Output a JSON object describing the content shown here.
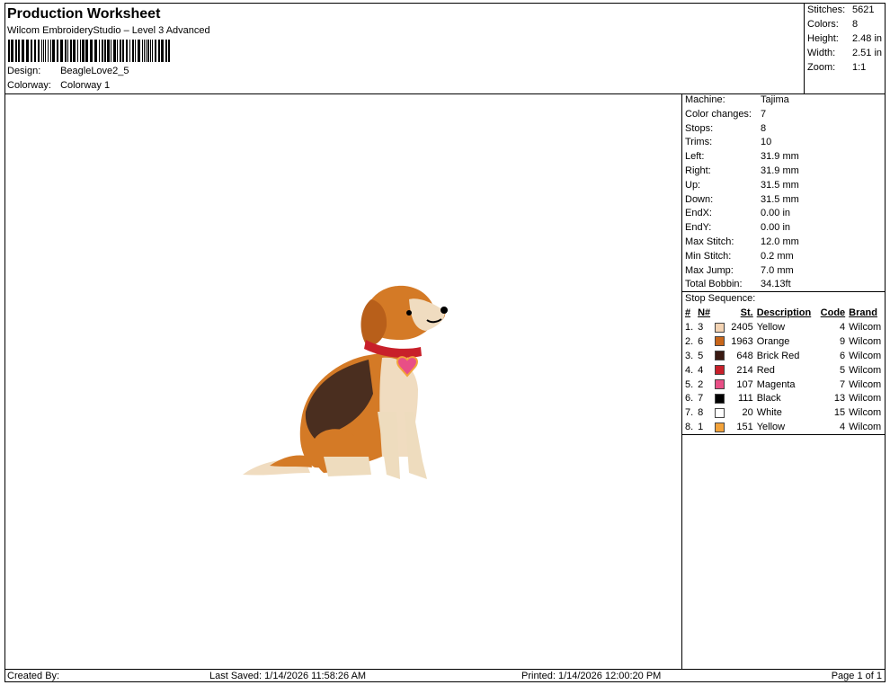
{
  "header": {
    "title": "Production Worksheet",
    "subtitle": "Wilcom EmbroideryStudio – Level 3 Advanced",
    "design_label": "Design:",
    "design_value": "BeagleLove2_5",
    "colorway_label": "Colorway:",
    "colorway_value": "Colorway 1"
  },
  "stats": [
    {
      "label": "Stitches:",
      "value": "5621"
    },
    {
      "label": "Colors:",
      "value": "8"
    },
    {
      "label": "Height:",
      "value": "2.48 in"
    },
    {
      "label": "Width:",
      "value": "2.51 in"
    },
    {
      "label": "Zoom:",
      "value": "1:1"
    }
  ],
  "machine_info": [
    {
      "label": "Machine:",
      "value": "Tajima"
    },
    {
      "label": "Color changes:",
      "value": "7"
    },
    {
      "label": "Stops:",
      "value": "8"
    },
    {
      "label": "Trims:",
      "value": "10"
    },
    {
      "label": "Left:",
      "value": "31.9 mm"
    },
    {
      "label": "Right:",
      "value": "31.9 mm"
    },
    {
      "label": "Up:",
      "value": "31.5 mm"
    },
    {
      "label": "Down:",
      "value": "31.5 mm"
    },
    {
      "label": "EndX:",
      "value": "0.00 in"
    },
    {
      "label": "EndY:",
      "value": "0.00 in"
    },
    {
      "label": "Max Stitch:",
      "value": "12.0 mm"
    },
    {
      "label": "Min Stitch:",
      "value": "0.2 mm"
    },
    {
      "label": "Max Jump:",
      "value": "7.0 mm"
    },
    {
      "label": "Total Bobbin:",
      "value": "34.13ft"
    }
  ],
  "stop_sequence": {
    "title": "Stop Sequence:",
    "headers": {
      "num": "#",
      "n": "N#",
      "st": "St.",
      "desc": "Description",
      "code": "Code",
      "brand": "Brand"
    },
    "rows": [
      {
        "num": "1.",
        "n": "3",
        "color": "#f3d3b3",
        "st": "2405",
        "desc": "Yellow",
        "code": "4",
        "brand": "Wilcom"
      },
      {
        "num": "2.",
        "n": "6",
        "color": "#c8661a",
        "st": "1963",
        "desc": "Orange",
        "code": "9",
        "brand": "Wilcom"
      },
      {
        "num": "3.",
        "n": "5",
        "color": "#3a1a12",
        "st": "648",
        "desc": "Brick Red",
        "code": "6",
        "brand": "Wilcom"
      },
      {
        "num": "4.",
        "n": "4",
        "color": "#c8202a",
        "st": "214",
        "desc": "Red",
        "code": "5",
        "brand": "Wilcom"
      },
      {
        "num": "5.",
        "n": "2",
        "color": "#e84f86",
        "st": "107",
        "desc": "Magenta",
        "code": "7",
        "brand": "Wilcom"
      },
      {
        "num": "6.",
        "n": "7",
        "color": "#000000",
        "st": "111",
        "desc": "Black",
        "code": "13",
        "brand": "Wilcom"
      },
      {
        "num": "7.",
        "n": "8",
        "color": "#ffffff",
        "st": "20",
        "desc": "White",
        "code": "15",
        "brand": "Wilcom"
      },
      {
        "num": "8.",
        "n": "1",
        "color": "#f2a23a",
        "st": "151",
        "desc": "Yellow",
        "code": "4",
        "brand": "Wilcom"
      }
    ]
  },
  "footer": {
    "created_by": "Created By:",
    "last_saved": "Last Saved: 1/14/2026 11:58:26 AM",
    "printed": "Printed: 1/14/2026 12:00:20 PM",
    "page": "Page 1 of 1"
  }
}
